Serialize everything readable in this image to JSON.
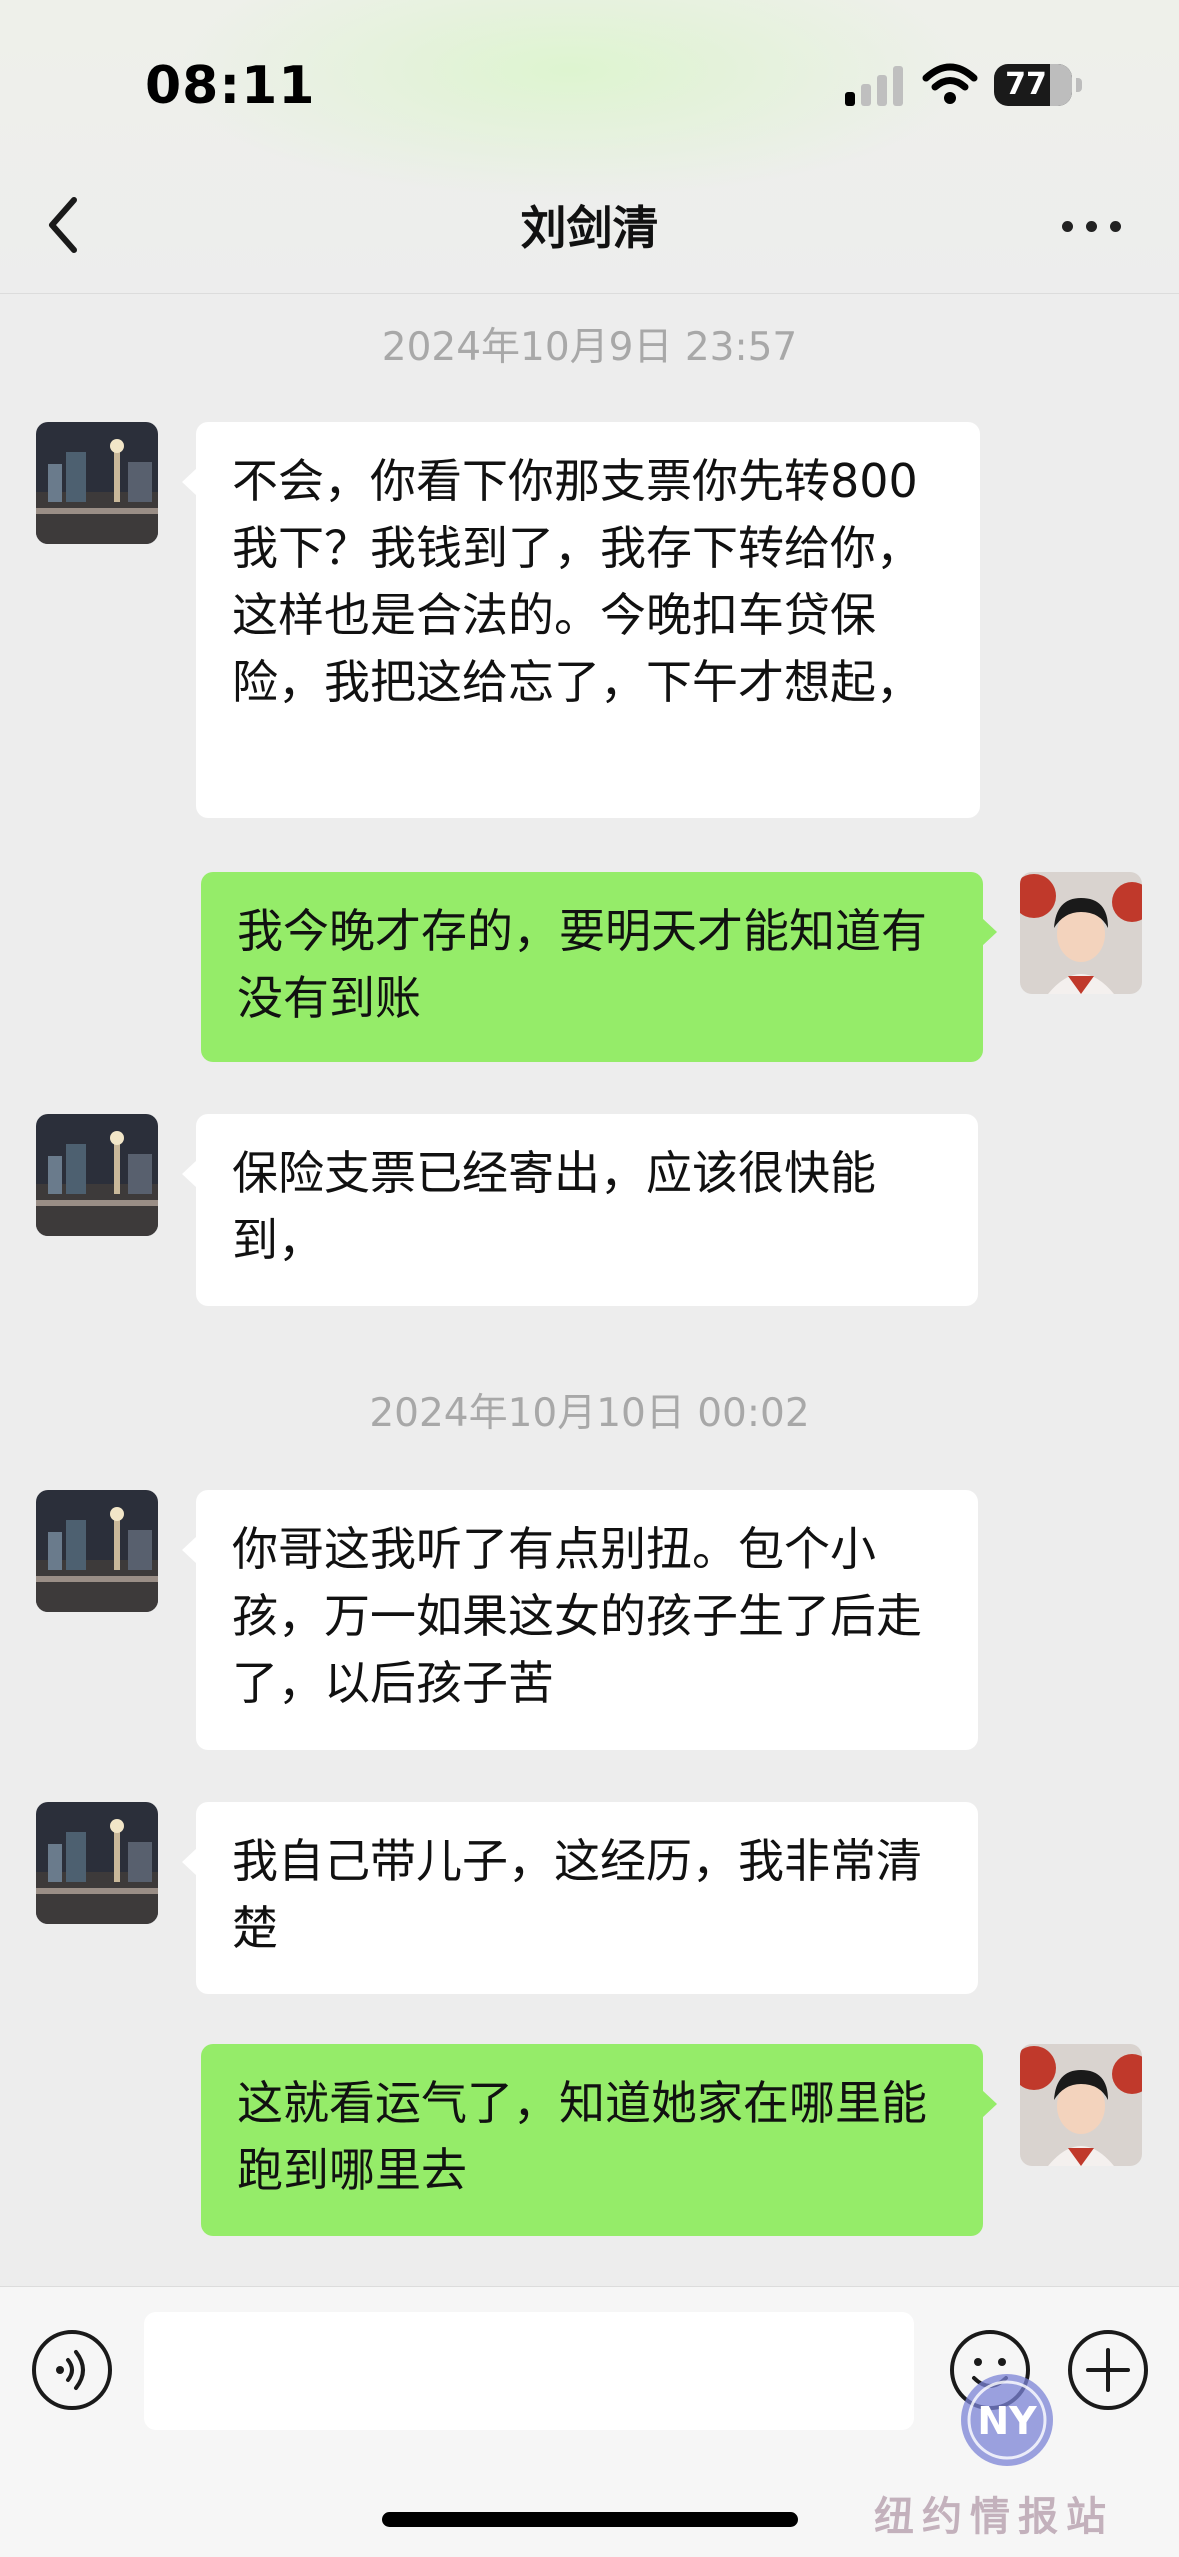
{
  "status_bar": {
    "time": "08:11",
    "battery": "77",
    "signal_bars_active": 1
  },
  "header": {
    "title": "刘剑清",
    "back_icon": "chevron-left-icon",
    "more_icon": "more-dots-icon"
  },
  "messages": {
    "ts1": "2024年10月9日 23:57",
    "m1": "不会，你看下你那支票你先转800我下？我钱到了，我存下转给你，这样也是合法的。今晚扣车贷保险，我把这给忘了，下午才想起，",
    "m2": "我今晚才存的，要明天才能知道有没有到账",
    "m3": "保险支票已经寄出，应该很快能到，",
    "ts2": "2024年10月10日 00:02",
    "m4": "你哥这我听了有点别扭。包个小孩，万一如果这女的孩子生了后走了，以后孩子苦",
    "m5": "我自己带儿子，这经历，我非常清楚",
    "m6": "这就看运气了，知道她家在哪里能跑到哪里去"
  },
  "input_bar": {
    "text_value": "",
    "voice_icon": "voice-icon",
    "emoji_icon": "emoji-icon",
    "plus_icon": "plus-icon"
  },
  "watermark": {
    "text": "纽约情报站",
    "logo_letters": "NY"
  },
  "colors": {
    "outgoing_bubble": "#95ec69",
    "incoming_bubble": "#ffffff",
    "background": "#ededed"
  }
}
